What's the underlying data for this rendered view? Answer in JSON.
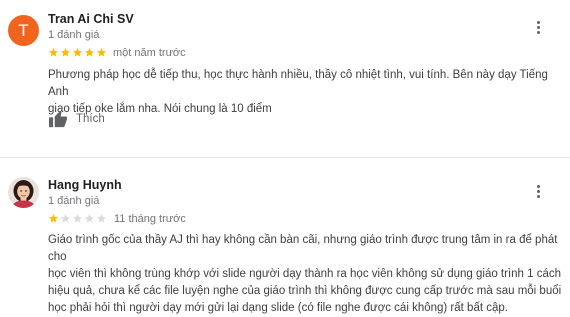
{
  "reviews": [
    {
      "avatar_letter": "T",
      "name": "Tran Ai Chi SV",
      "review_count": "1 đánh giá",
      "rating": 5,
      "time": "một năm trước",
      "text_lines": [
        "Phương pháp học dễ tiếp thu, học thực hành nhiều, thầy cô nhiệt tình, vui tính. Bên này dạy Tiếng Anh",
        "giao tiếp oke lắm nha. Nói chung là 10 điểm"
      ],
      "like_label": "Thích"
    },
    {
      "avatar_icon": "user-photo-avatar",
      "name": "Hang Huynh",
      "review_count": "1 đánh giá",
      "rating": 1,
      "time": "11 tháng trước",
      "text_lines": [
        "Giáo trình gốc của thầy AJ thì hay không cần bàn cãi, nhưng giáo trình được trung tâm in ra để phát cho",
        "học viên thì không trùng khớp với slide người dạy thành ra học viên không sử dụng giáo trình 1 cách",
        "hiệu quả, chưa kể các file luyện nghe của giáo trình thì không được cung cấp trước mà sau mỗi buổi",
        "học phải hỏi thì người dạy mới gửi lại dạng slide (có file nghe được cái không) rất bất cập."
      ]
    }
  ],
  "colors": {
    "star_filled": "#fbbc04",
    "star_empty": "#dadce0",
    "avatar_bg": "#f1641e"
  },
  "icons": {
    "more": "more-vert-icon",
    "like": "thumbs-up-icon",
    "star": "star-icon"
  }
}
